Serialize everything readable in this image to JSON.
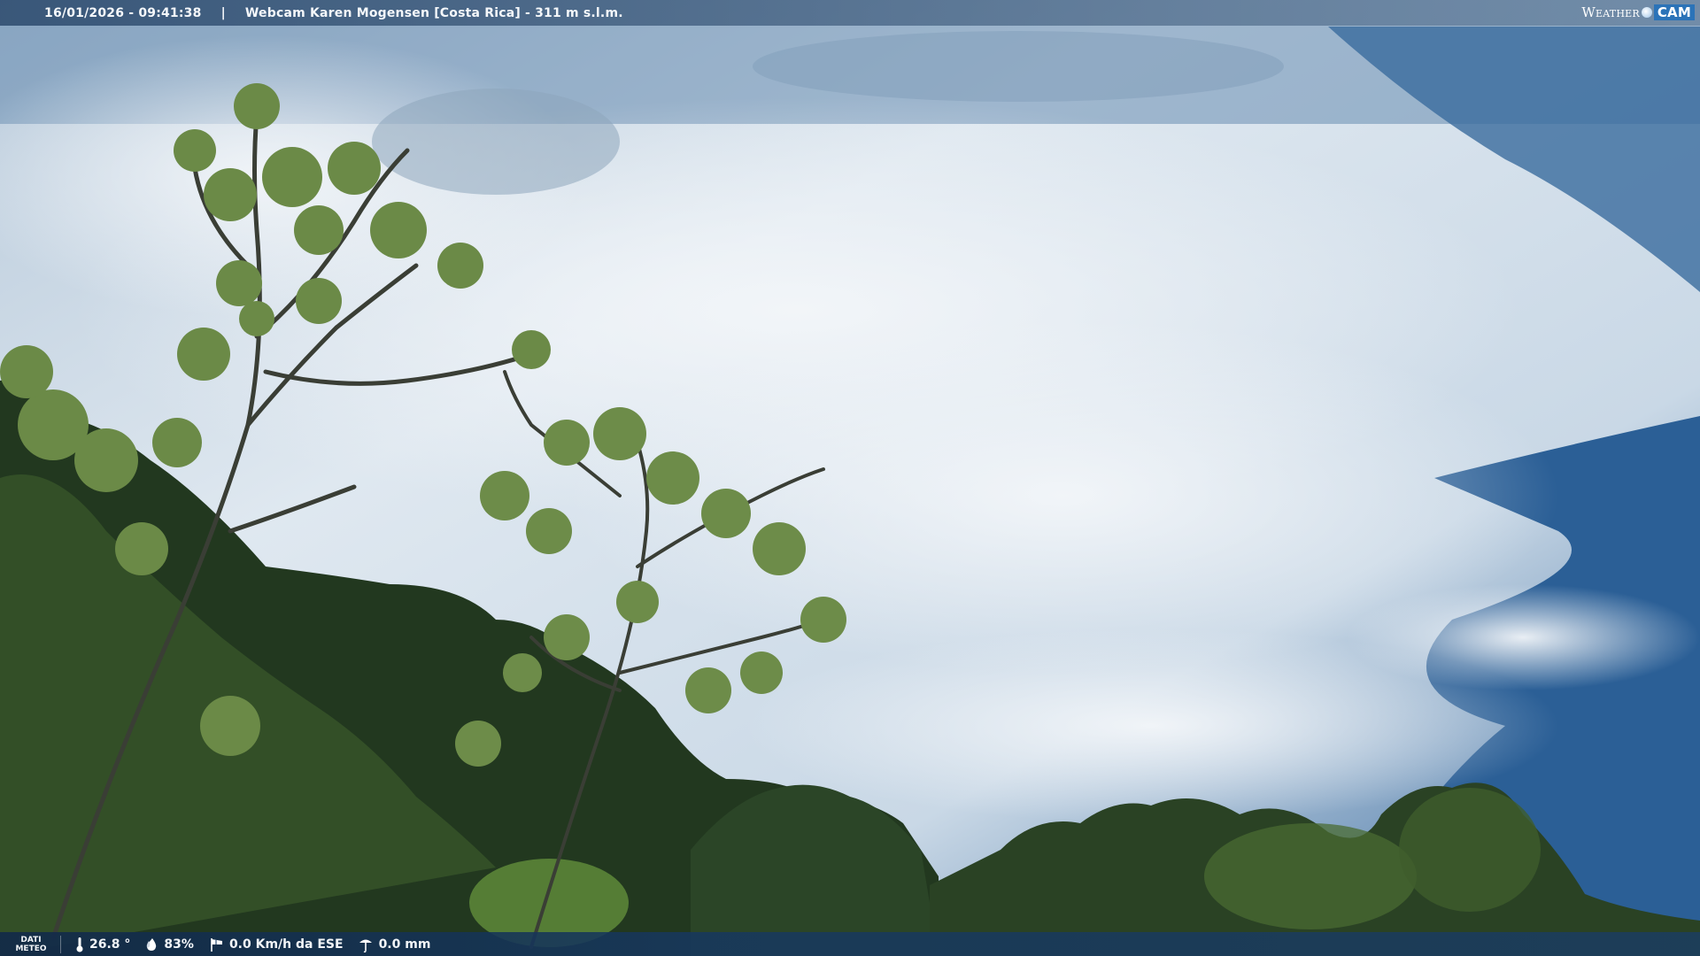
{
  "overlay": {
    "timestamp": "16/01/2026 - 09:41:38",
    "separator": "|",
    "station": "Webcam Karen Mogensen [Costa Rica] - 311 m s.l.m.",
    "logo": {
      "weather": "Weather",
      "cam": "CAM"
    }
  },
  "meteo": {
    "label_line1": "DATI",
    "label_line2": "METEO",
    "temperature": "26.8 °",
    "humidity": "83%",
    "wind": "0.0 Km/h da ESE",
    "rain": "0.0 mm"
  },
  "colors": {
    "sky_top": "#3d6a98",
    "sky_cloud": "#dfe8f0",
    "sky_deep": "#2a5f97",
    "foliage_dark": "#1d2e1c",
    "foliage_mid": "#3d5a2c",
    "leaf_highlight": "#6f8f4a"
  },
  "icons": {
    "temperature": "thermometer-icon",
    "humidity": "droplet-icon",
    "wind": "windsock-icon",
    "rain": "rain-gauge-icon"
  }
}
